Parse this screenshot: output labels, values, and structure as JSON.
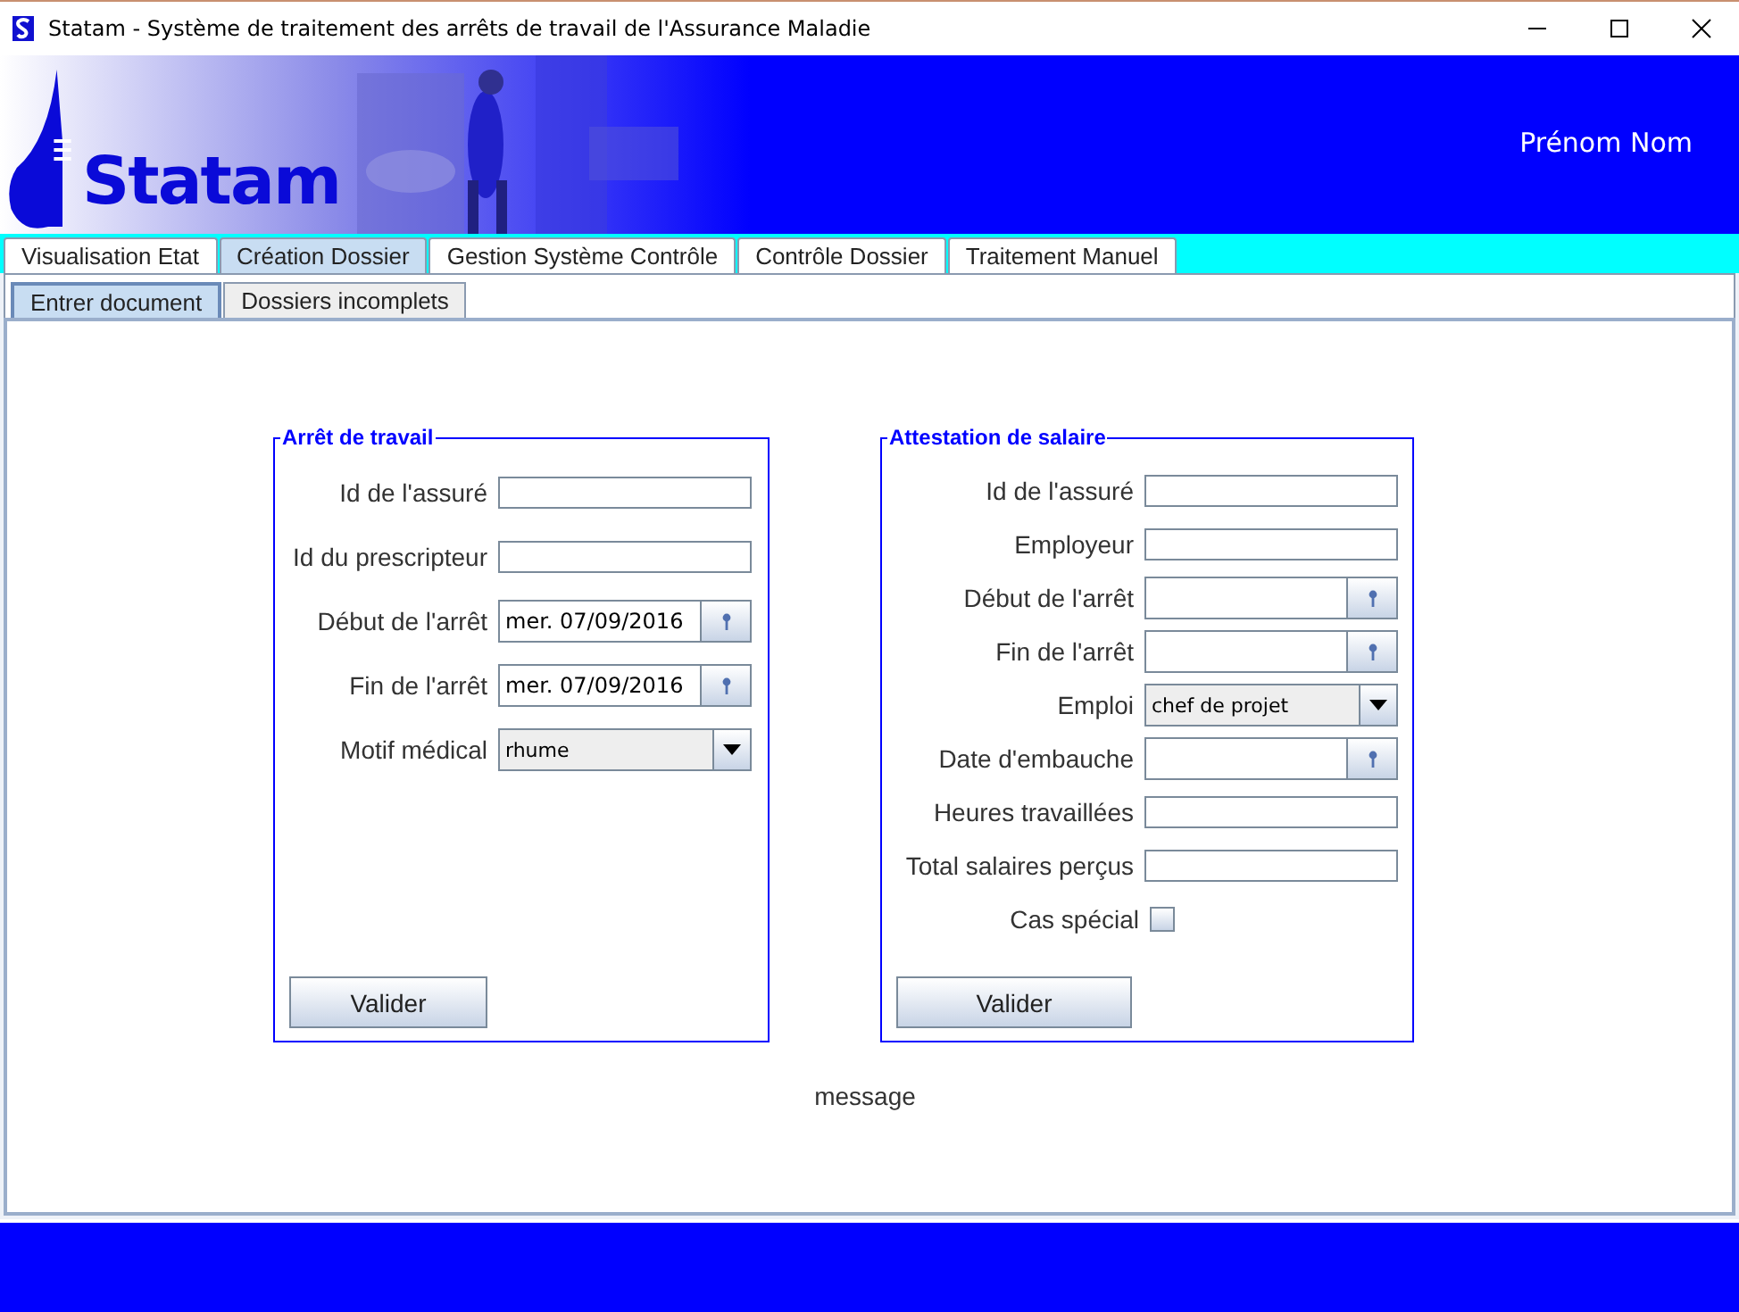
{
  "window": {
    "title": "Statam - Système de traitement des arrêts de travail de l'Assurance Maladie"
  },
  "banner": {
    "logo": "Statam",
    "user": "Prénom Nom"
  },
  "tabs": [
    {
      "label": "Visualisation Etat",
      "selected": false
    },
    {
      "label": "Création Dossier",
      "selected": true
    },
    {
      "label": "Gestion Système Contrôle",
      "selected": false
    },
    {
      "label": "Contrôle Dossier",
      "selected": false
    },
    {
      "label": "Traitement Manuel",
      "selected": false
    }
  ],
  "subtabs": [
    {
      "label": "Entrer document",
      "selected": true
    },
    {
      "label": "Dossiers incomplets",
      "selected": false
    }
  ],
  "panels": [
    {
      "title": "Arrêt de travail",
      "fields": [
        {
          "kind": "text",
          "label": "Id de l'assuré"
        },
        {
          "kind": "text",
          "label": "Id du prescripteur"
        },
        {
          "kind": "date",
          "label": "Début de l'arrêt",
          "value": "mer. 07/09/2016"
        },
        {
          "kind": "date",
          "label": "Fin de l'arrêt",
          "value": "mer. 07/09/2016"
        },
        {
          "kind": "select",
          "label": "Motif médical",
          "value": "rhume"
        }
      ],
      "button": "Valider"
    },
    {
      "title": "Attestation de salaire",
      "fields": [
        {
          "kind": "text",
          "label": "Id de l'assuré"
        },
        {
          "kind": "text",
          "label": "Employeur"
        },
        {
          "kind": "date",
          "label": "Début de l'arrêt"
        },
        {
          "kind": "date",
          "label": "Fin de l'arrêt"
        },
        {
          "kind": "select",
          "label": "Emploi",
          "value": "chef de projet"
        },
        {
          "kind": "date",
          "label": "Date d'embauche"
        },
        {
          "kind": "text",
          "label": "Heures travaillées"
        },
        {
          "kind": "text",
          "label": "Total salaires perçus"
        },
        {
          "kind": "checkbox",
          "label": "Cas spécial",
          "checked": false
        }
      ],
      "button": "Valider"
    }
  ],
  "message": "message"
}
